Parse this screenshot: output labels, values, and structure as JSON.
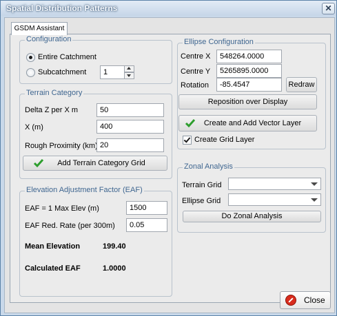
{
  "window": {
    "title": "Spatial Distribution Patterns",
    "close_glyph": "✕"
  },
  "tabs": [
    {
      "label": "GSDM Assistant"
    }
  ],
  "configuration": {
    "title": "Configuration",
    "entire_catchment": {
      "label": "Entire Catchment",
      "checked": true
    },
    "subcatchment": {
      "label": "Subcatchment",
      "checked": false,
      "value": "1"
    }
  },
  "terrain": {
    "title": "Terrain Category",
    "fields": [
      {
        "label": "Delta Z per X m",
        "value": "50"
      },
      {
        "label": "X (m)",
        "value": "400"
      },
      {
        "label": "Rough Proximity (km)",
        "value": "20"
      }
    ],
    "add_button": "Add Terrain Category Grid"
  },
  "eaf": {
    "title": "Elevation Adjustment Factor (EAF)",
    "fields": [
      {
        "label": "EAF = 1 Max Elev (m)",
        "value": "1500"
      },
      {
        "label": "EAF Red. Rate (per 300m)",
        "value": "0.05"
      }
    ],
    "mean_elevation": {
      "label": "Mean Elevation",
      "value": "199.40"
    },
    "calculated_eaf": {
      "label": "Calculated EAF",
      "value": "1.0000"
    }
  },
  "ellipse": {
    "title": "Ellipse Configuration",
    "centre_x": {
      "label": "Centre X",
      "value": "548264.0000"
    },
    "centre_y": {
      "label": "Centre Y",
      "value": "5265895.0000"
    },
    "rotation": {
      "label": "Rotation",
      "value": "-85.4547"
    },
    "redraw": "Redraw",
    "reposition": "Reposition over Display",
    "create_layer": "Create and Add Vector Layer",
    "create_grid": {
      "label": "Create Grid Layer",
      "checked": true
    }
  },
  "zonal": {
    "title": "Zonal Analysis",
    "terrain_grid": {
      "label": "Terrain Grid",
      "value": ""
    },
    "ellipse_grid": {
      "label": "Ellipse Grid",
      "value": ""
    },
    "button": "Do Zonal Analysis"
  },
  "footer": {
    "close_label": "Close"
  },
  "colors": {
    "group_title": "#3f6690",
    "check_icon": "#2e9e2e",
    "close_icon": "#d82c1e"
  },
  "icons": {
    "app": "app-icon",
    "check": "green-check-icon",
    "close": "red-circle-icon"
  }
}
